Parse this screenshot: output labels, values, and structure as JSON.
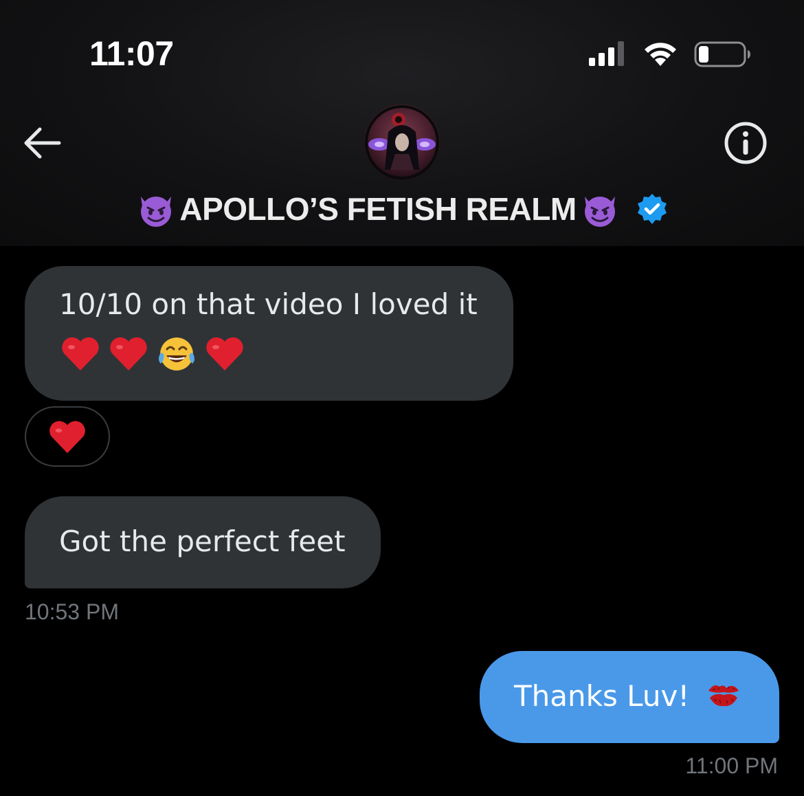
{
  "status_bar": {
    "time": "11:07",
    "signal_icon": "cellular-signal-icon",
    "wifi_icon": "wifi-icon",
    "battery_icon": "battery-low-icon",
    "battery_level": 0.2
  },
  "header": {
    "back_icon": "back-arrow-icon",
    "info_icon": "info-icon",
    "title": "APOLLO’S FETISH REALM",
    "title_prefix_emoji": "😈",
    "title_suffix_emoji": "😈",
    "verified_icon": "verified-badge-icon",
    "verified_color": "#1d9bf0"
  },
  "messages": [
    {
      "direction": "incoming",
      "text": "10/10 on that video I loved it",
      "emojis": [
        "❤️",
        "❤️",
        "😂",
        "❤️"
      ],
      "reaction": "❤️"
    },
    {
      "direction": "incoming",
      "text": "Got the perfect feet",
      "timestamp": "10:53 PM"
    },
    {
      "direction": "outgoing",
      "text": "Thanks Luv!",
      "emoji": "💋",
      "timestamp": "11:00 PM"
    }
  ],
  "colors": {
    "incoming_bubble": "#2f3336",
    "outgoing_bubble": "#4a99e9",
    "timestamp": "#71767b",
    "background": "#000000"
  }
}
